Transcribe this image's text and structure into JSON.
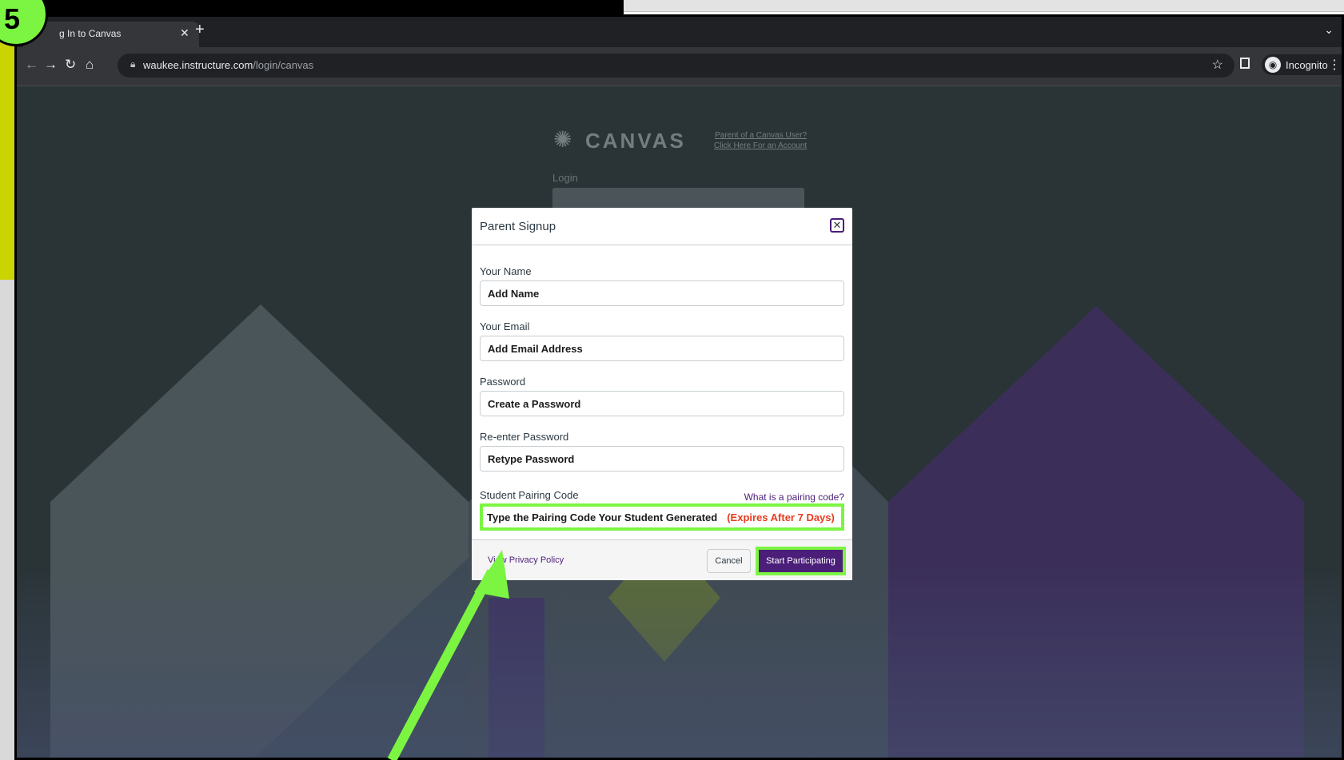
{
  "step_badge": "5",
  "browser": {
    "tab_title": "Log In to Canvas",
    "tab_title_visible": "g In to Canvas",
    "url_host": "waukee.instructure.com",
    "url_path": "/login/canvas",
    "profile_label": "Incognito"
  },
  "login_page": {
    "logo_text": "CANVAS",
    "parent_link_line1": "Parent of a Canvas User?",
    "parent_link_line2": "Click Here For an Account",
    "login_label": "Login"
  },
  "modal": {
    "title": "Parent Signup",
    "close_glyph": "✕",
    "fields": [
      {
        "label": "Your Name",
        "value": "Add Name"
      },
      {
        "label": "Your Email",
        "value": "Add Email Address"
      },
      {
        "label": "Password",
        "value": "Create a Password"
      },
      {
        "label": "Re-enter Password",
        "value": "Retype Password"
      }
    ],
    "pairing": {
      "label": "Student Pairing Code",
      "help_link": "What is a pairing code?",
      "value": "Type the Pairing Code Your Student Generated",
      "note": "(Expires After 7 Days)"
    },
    "footer": {
      "privacy_link": "View Privacy Policy",
      "cancel": "Cancel",
      "submit": "Start Participating"
    }
  },
  "colors": {
    "highlight": "#7bf542",
    "brand_purple": "#4b1e79",
    "expires_red": "#e63b1e",
    "page_bg": "#2a3437"
  },
  "icons": [
    "back-arrow-icon",
    "forward-arrow-icon",
    "reload-icon",
    "home-icon",
    "lock-icon",
    "star-icon",
    "side-panel-icon",
    "incognito-icon",
    "kebab-menu-icon",
    "close-icon",
    "canvas-logo-icon"
  ]
}
